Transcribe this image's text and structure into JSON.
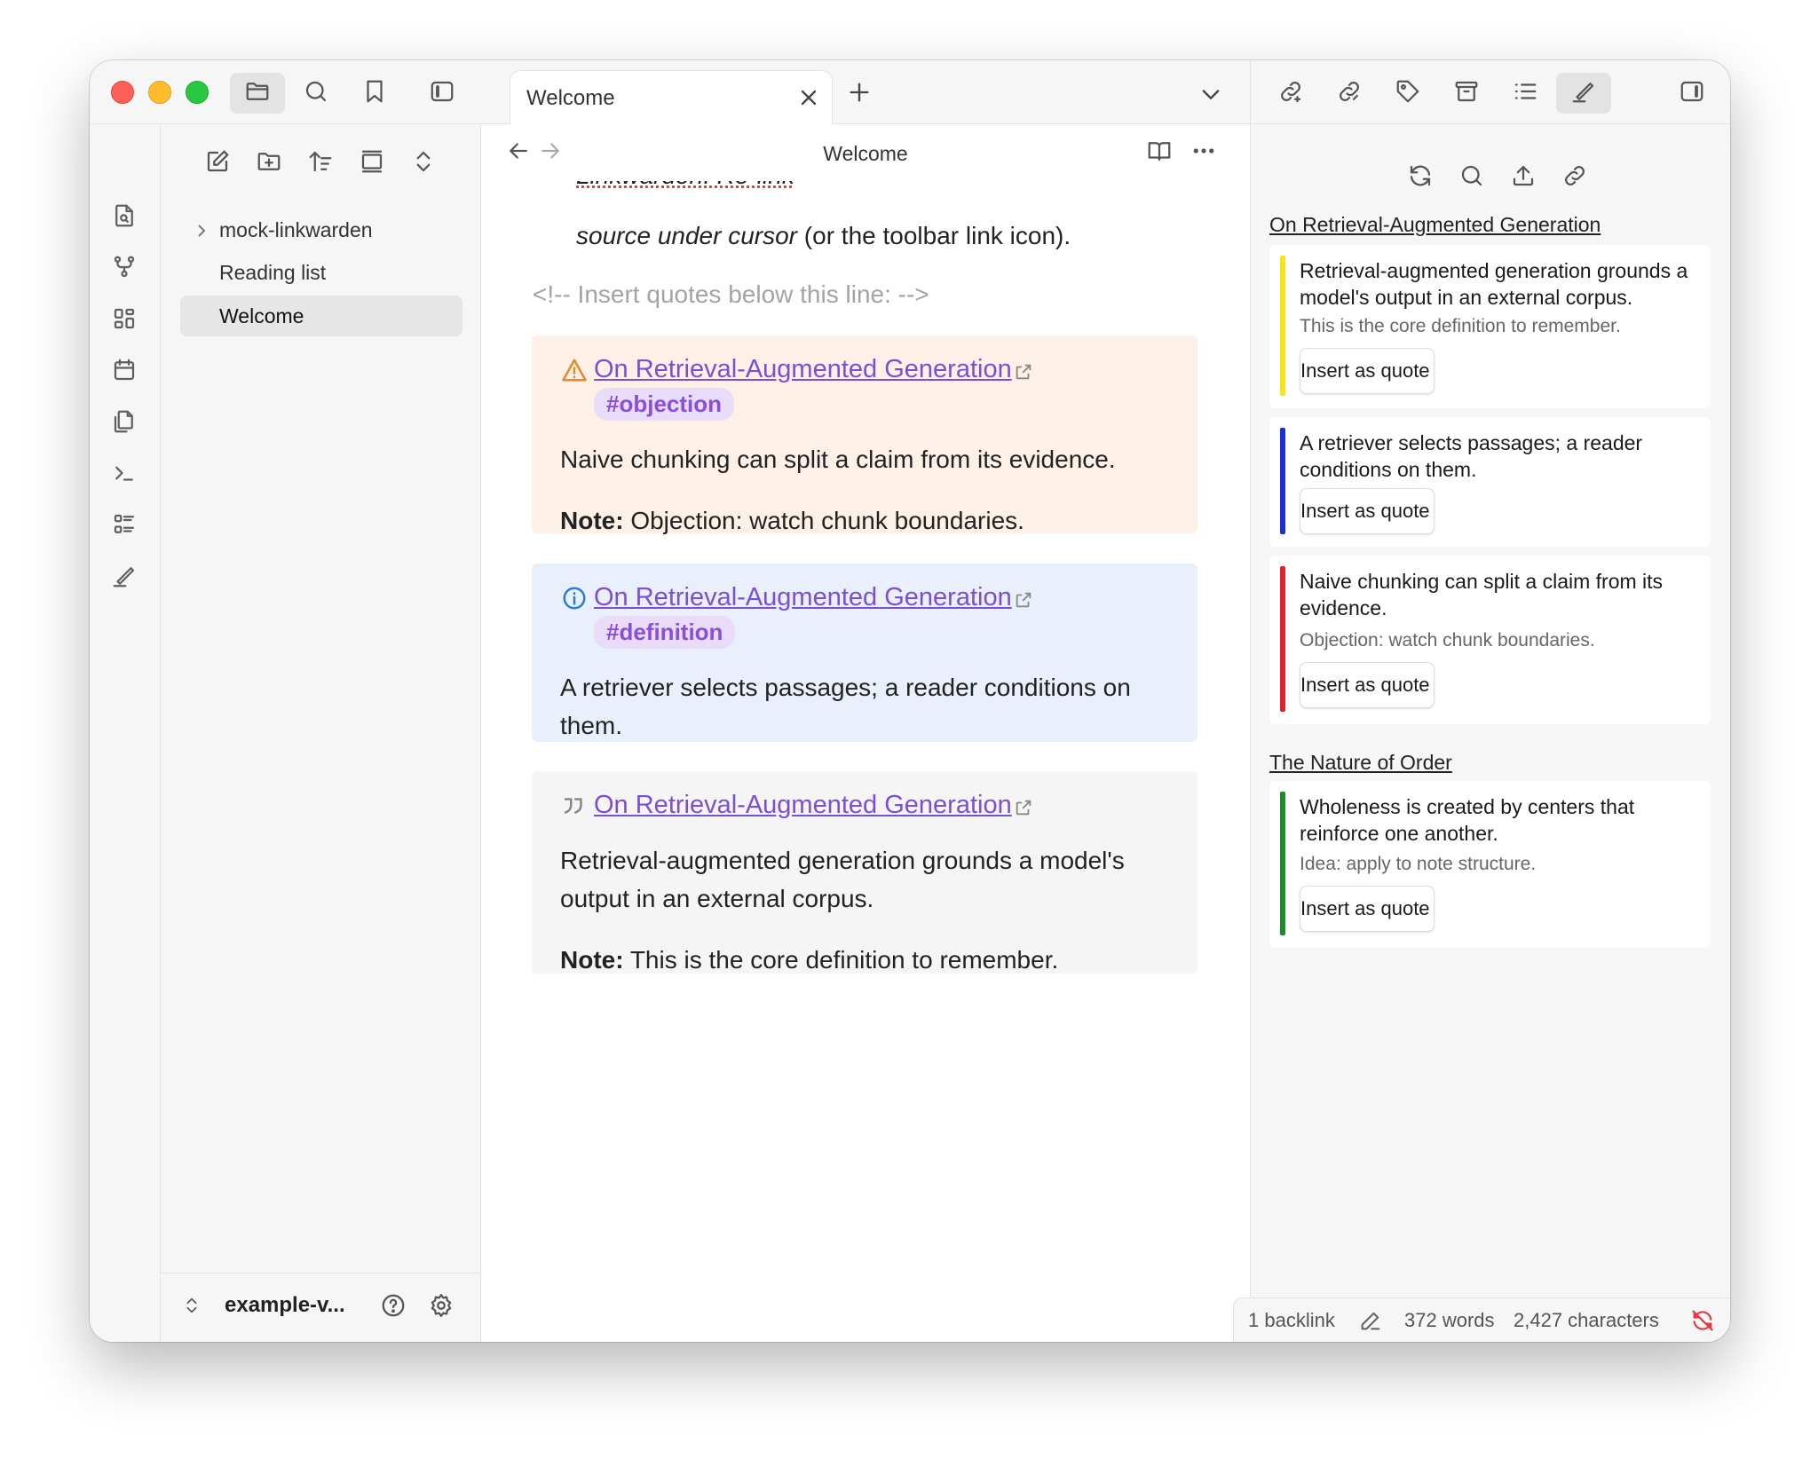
{
  "window": {
    "traffic_lights": {
      "close": "#fe5f57",
      "minimize": "#febc2e",
      "zoom": "#28c840"
    },
    "titlebar_icons": [
      "folder-icon",
      "search-icon",
      "bookmark-icon",
      "sidebar-toggle-icon"
    ]
  },
  "ribbon": {
    "icons": [
      "file-search-icon",
      "graph-icon",
      "canvas-icon",
      "calendar-icon",
      "copy-icon",
      "terminal-icon",
      "list-icon",
      "highlighter-icon"
    ]
  },
  "explorer": {
    "tools": [
      "new-note-icon",
      "new-folder-icon",
      "sort-icon",
      "collapse-icon",
      "expand-icon"
    ],
    "items": [
      {
        "label": "mock-linkwarden",
        "type": "folder"
      },
      {
        "label": "Reading list",
        "type": "file"
      },
      {
        "label": "Welcome",
        "type": "file",
        "active": true
      }
    ],
    "vault": {
      "name": "example-v..."
    }
  },
  "tabs": [
    {
      "title": "Welcome"
    }
  ],
  "view": {
    "title": "Welcome"
  },
  "content": {
    "cut_line": "Linkwarden: Re-link",
    "para_em": "source under cursor",
    "para_rest": " (or the toolbar link icon).",
    "comment": "<!-- Insert quotes below this line: -->",
    "callouts": [
      {
        "kind": "warning",
        "bg": "#fdf0e6",
        "icon_color": "#e6892a",
        "title": "On Retrieval-Augmented Generation",
        "tag": "#objection",
        "body": "Naive chunking can split a claim from its evidence.",
        "note_label": "Note:",
        "note": " Objection: watch chunk boundaries."
      },
      {
        "kind": "info",
        "bg": "#e9f0fb",
        "icon_color": "#2a7bd4",
        "title": "On Retrieval-Augmented Generation",
        "tag": "#definition",
        "body": "A retriever selects passages; a reader conditions on them."
      },
      {
        "kind": "quote",
        "bg": "#f5f5f5",
        "icon_color": "#888888",
        "title": "On Retrieval-Augmented Generation",
        "body": "Retrieval-augmented generation grounds a model's output in an external corpus.",
        "note_label": "Note:",
        "note": " This is the core definition to remember."
      }
    ]
  },
  "right_panel": {
    "tabs": [
      "link-icon",
      "unlink-icon",
      "tag-icon",
      "archive-icon",
      "outline-icon",
      "highlighter-icon"
    ],
    "tools": [
      "refresh-icon",
      "search-icon",
      "upload-icon",
      "link-icon"
    ],
    "sources": [
      {
        "title": "On Retrieval-Augmented Generation",
        "highlights": [
          {
            "text": "Retrieval-augmented generation grounds a model's output in an external corpus.",
            "note": "This is the core definition to remember.",
            "color": "#f5e51a",
            "button": "Insert as quote"
          },
          {
            "text": "A retriever selects passages; a reader conditions on them.",
            "note": "",
            "color": "#1f2fd6",
            "button": "Insert as quote"
          },
          {
            "text": "Naive chunking can split a claim from its evidence.",
            "note": "Objection: watch chunk boundaries.",
            "color": "#e3232b",
            "button": "Insert as quote"
          }
        ]
      },
      {
        "title": "The Nature of Order",
        "highlights": [
          {
            "text": "Wholeness is created by centers that reinforce one another.",
            "note": "Idea: apply to note structure.",
            "color": "#1e8a2c",
            "button": "Insert as quote"
          }
        ]
      }
    ]
  },
  "statusbar": {
    "backlinks": "1 backlink",
    "words": "372 words",
    "characters": "2,427 characters",
    "sync_error_color": "#e0363d"
  }
}
